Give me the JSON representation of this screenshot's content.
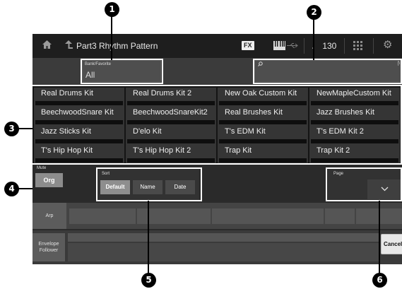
{
  "topbar": {
    "home_icon": "home-icon",
    "up_icon": "up-arrow-icon",
    "part_title": "Part3  Rhythm Pattern",
    "fx_badge": "FX",
    "keyboard_icon": "keyboard-icon",
    "usb_icon": "usb-icon",
    "tempo": "♩ 130",
    "grid_icon": "grid-icon",
    "gear_icon": "gear-icon"
  },
  "bank": {
    "label": "Bank/Favorite",
    "value": "All"
  },
  "search": {
    "icon": "search-icon",
    "ext_label": "[\\"
  },
  "kits": [
    "Real Drums Kit",
    "Real Drums Kit 2",
    "New Oak Custom Kit",
    "NewMapleCustom Kit",
    "BeechwoodSnare Kit",
    "BeechwoodSnareKit2",
    "Real Brushes Kit",
    "Jazz Brushes Kit",
    "Jazz Sticks Kit",
    "D'elo Kit",
    "T's EDM Kit",
    "T's EDM Kit 2",
    "T's Hip Hop Kit",
    "T's Hip Hop Kit 2",
    "Trap Kit",
    "Trap Kit 2"
  ],
  "mute": {
    "label": "Mute",
    "button": "Org"
  },
  "sort": {
    "label": "Sort",
    "options": [
      "Default",
      "Name",
      "Date"
    ],
    "selected": "Default"
  },
  "page": {
    "label": "Page"
  },
  "arp": {
    "label": "Arp"
  },
  "envelope": {
    "label_line1": "Envelope",
    "label_line2": "Follower"
  },
  "cancel_label": "Cancel",
  "callouts": [
    "1",
    "2",
    "3",
    "4",
    "5",
    "6"
  ],
  "colors": {
    "screen_bg": "#2b2b2b",
    "topbar_bg": "#1e1e1e",
    "highlight": "#ffffff",
    "callout": "#000000"
  }
}
